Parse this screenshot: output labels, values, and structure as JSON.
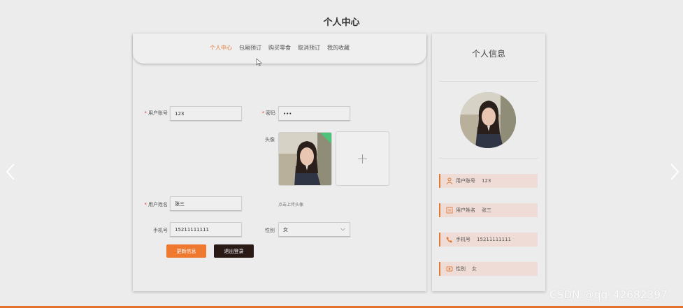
{
  "page": {
    "title": "个人中心"
  },
  "nav": {
    "items": [
      {
        "label": "个人中心",
        "active": true
      },
      {
        "label": "包厢预订",
        "active": false
      },
      {
        "label": "购买零食",
        "active": false
      },
      {
        "label": "取消预订",
        "active": false
      },
      {
        "label": "我的收藏",
        "active": false
      }
    ]
  },
  "form": {
    "required_mark": "*",
    "account": {
      "label": "用户账号",
      "value": "123"
    },
    "password": {
      "label": "密码",
      "value": "•••"
    },
    "avatar": {
      "label": "头像",
      "plus": "+",
      "hint": "点击上传头像"
    },
    "name": {
      "label": "用户姓名",
      "value": "张三"
    },
    "phone": {
      "label": "手机号",
      "value": "15211111111"
    },
    "gender": {
      "label": "性别",
      "value": "女"
    },
    "save_label": "更新信息",
    "logout_label": "退出登录"
  },
  "profile": {
    "title": "个人信息",
    "rows": [
      {
        "label": "用户账号",
        "value": "123",
        "icon": "user-icon"
      },
      {
        "label": "用户姓名",
        "value": "张三",
        "icon": "id-card-icon"
      },
      {
        "label": "手机号",
        "value": "15211111111",
        "icon": "phone-icon"
      },
      {
        "label": "性别",
        "value": "女",
        "icon": "gender-icon"
      }
    ]
  },
  "watermark": "CSDN @qq_42682397",
  "colors": {
    "accent": "#e07a35",
    "save": "#ef7a2f",
    "logout": "#2a1a16",
    "info_row": "#f0dcd6"
  }
}
